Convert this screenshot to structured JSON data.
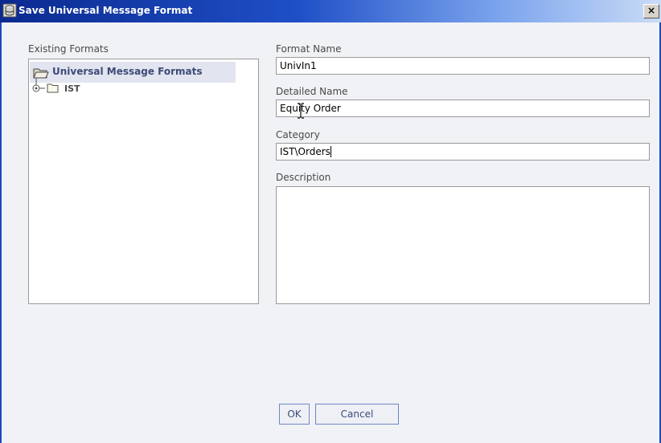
{
  "window": {
    "title": "Save Universal Message Format",
    "close_label": "×"
  },
  "left_panel": {
    "label": "Existing Formats",
    "tree": {
      "root_label": "Universal Message Formats",
      "children": [
        {
          "label": "IST"
        }
      ]
    }
  },
  "form": {
    "format_name": {
      "label": "Format Name",
      "value": "UnivIn1"
    },
    "detailed_name": {
      "label": "Detailed Name",
      "value": "Equity Order"
    },
    "category": {
      "label": "Category",
      "value": "IST\\Orders"
    },
    "description": {
      "label": "Description",
      "value": ""
    }
  },
  "buttons": {
    "ok_label": "OK",
    "cancel_label": "Cancel"
  },
  "colors": {
    "titlebar_start": "#0b2a8f",
    "titlebar_end": "#c9dbf7",
    "dialog_bg": "#f1f2f6",
    "selection_bg": "#e2e5ef",
    "button_border": "#6f88c2",
    "label_text": "#4a4a4a"
  },
  "icons": {
    "window_icon": "database-icon",
    "root_icon": "open-folder-icon",
    "child_icon": "folder-icon",
    "expander_icon": "tree-expander-icon"
  }
}
